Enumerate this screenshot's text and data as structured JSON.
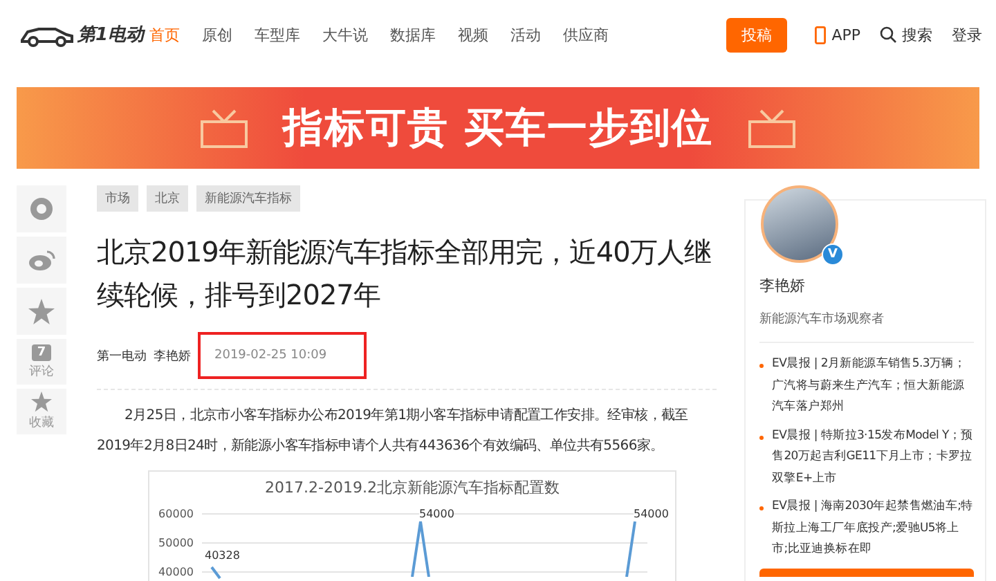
{
  "header": {
    "logo": "第1电动",
    "nav": [
      {
        "label": "首页",
        "selected": true
      },
      {
        "label": "原创",
        "selected": false
      },
      {
        "label": "车型库",
        "selected": false
      },
      {
        "label": "大牛说",
        "selected": false
      },
      {
        "label": "数据库",
        "selected": false
      },
      {
        "label": "视频",
        "selected": false
      },
      {
        "label": "活动",
        "selected": false
      },
      {
        "label": "供应商",
        "selected": false
      }
    ],
    "submit": "投稿",
    "app": "APP",
    "search": "搜索",
    "login": "登录"
  },
  "banner": {
    "text": "指标可贵 买车一步到位"
  },
  "share": {
    "comments": "7",
    "comment_label": "评论",
    "favorite_label": "收藏"
  },
  "article": {
    "tags": [
      "市场",
      "北京",
      "新能源汽车指标"
    ],
    "title": "北京2019年新能源汽车指标全部用完，近40万人继续轮候，排号到2027年",
    "source": "第一电动",
    "author": "李艳娇",
    "date": "2019-02-25 10:09",
    "date_highlighted": true,
    "paragraph": "2月25日，北京市小客车指标办公布2019年第1期小客车指标申请配置工作安排。经审核，截至2019年2月8日24时，新能源小客车指标申请个人共有443636个有效编码、单位共有5566家。",
    "chart": {
      "title": "2017.2-2019.2北京新能源汽车指标配置数",
      "y_labels": [
        "60000",
        "50000",
        "40000"
      ],
      "point_labels": [
        "40328",
        "54000",
        "54000"
      ]
    }
  },
  "sidebar": {
    "name": "李艳娇",
    "verified": "V",
    "role": "新能源汽车市场观察者",
    "news": [
      "EV晨报 | 2月新能源车销售5.3万辆；广汽将与蔚来生产汽车；恒大新能源汽车落户郑州",
      "EV晨报 | 特斯拉3·15发布Model Y；预售20万起吉利GE11下月上市；卡罗拉双擎E+上市",
      "EV晨报 | 海南2030年起禁售燃油车;特斯拉上海工厂年底投产;爱驰U5将上市;比亚迪换标在即"
    ]
  }
}
